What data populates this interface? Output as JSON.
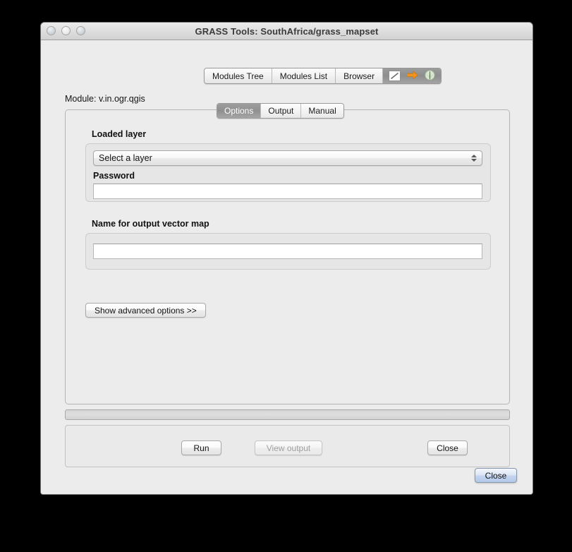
{
  "window": {
    "title": "GRASS Tools: SouthAfrica/grass_mapset",
    "traffic_lights": [
      "close-button",
      "minimize-button",
      "zoom-button"
    ]
  },
  "top_tabs": {
    "items": [
      {
        "label": "Modules Tree",
        "selected": false
      },
      {
        "label": "Modules List",
        "selected": false
      },
      {
        "label": "Browser",
        "selected": false
      }
    ],
    "icon_segment": {
      "selected": true,
      "icons": [
        "diagonal-line-icon",
        "orange-arrow-icon",
        "grass-logo-icon"
      ]
    }
  },
  "module": {
    "label": "Module: v.in.ogr.qgis"
  },
  "mid_tabs": {
    "items": [
      {
        "label": "Options",
        "selected": true
      },
      {
        "label": "Output",
        "selected": false
      },
      {
        "label": "Manual",
        "selected": false
      }
    ]
  },
  "options": {
    "loaded_layer": {
      "label": "Loaded layer",
      "combo_value": "Select a layer",
      "password_label": "Password",
      "password_value": "",
      "password_placeholder": ""
    },
    "output_map": {
      "label": "Name for output vector map",
      "value": "",
      "placeholder": ""
    },
    "advanced_button": "Show advanced options >>"
  },
  "progress": {
    "value": 0,
    "max": 100
  },
  "actions": {
    "run": "Run",
    "view_output": "View output",
    "view_output_enabled": false,
    "close": "Close"
  },
  "footer": {
    "close": "Close"
  },
  "colors": {
    "window_bg": "#ececec",
    "group_bg": "#e6e6e6",
    "accent_orange": "#f0921e",
    "grass_green": "#3f8f2b",
    "selected_tab_bg": "#969696",
    "default_button_blue": "#c3d4ee"
  }
}
